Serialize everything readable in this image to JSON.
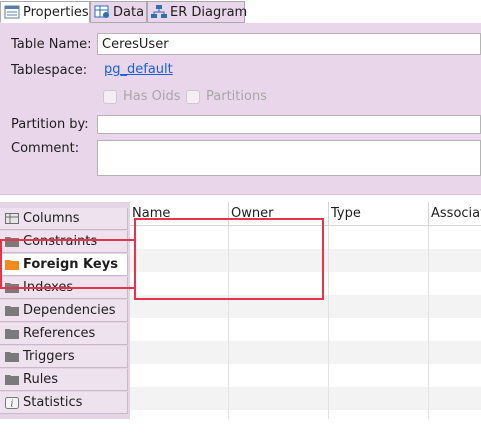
{
  "tabs": [
    {
      "label": "Properties",
      "icon": "properties-icon",
      "active": true
    },
    {
      "label": "Data",
      "icon": "data-icon",
      "active": false
    },
    {
      "label": "ER Diagram",
      "icon": "er-diagram-icon",
      "active": false
    }
  ],
  "form": {
    "table_name_label": "Table Name:",
    "table_name_value": "CeresUser",
    "tablespace_label": "Tablespace:",
    "tablespace_value": "pg_default",
    "has_oids_label": "Has Oids",
    "partitions_label": "Partitions",
    "partition_by_label": "Partition by:",
    "partition_by_value": "",
    "comment_label": "Comment:",
    "comment_value": ""
  },
  "sections": [
    {
      "label": "Columns",
      "icon": "columns-icon",
      "selected": false
    },
    {
      "label": "Constraints",
      "icon": "folder-icon",
      "selected": false
    },
    {
      "label": "Foreign Keys",
      "icon": "folder-orange-icon",
      "selected": true
    },
    {
      "label": "Indexes",
      "icon": "folder-icon",
      "selected": false
    },
    {
      "label": "Dependencies",
      "icon": "folder-icon",
      "selected": false
    },
    {
      "label": "References",
      "icon": "folder-icon",
      "selected": false
    },
    {
      "label": "Triggers",
      "icon": "folder-icon",
      "selected": false
    },
    {
      "label": "Rules",
      "icon": "folder-icon",
      "selected": false
    },
    {
      "label": "Statistics",
      "icon": "info-icon",
      "selected": false
    }
  ],
  "grid": {
    "columns": [
      "Name",
      "Owner",
      "Type",
      "Associat"
    ]
  },
  "colors": {
    "panel": "#e9d6ea",
    "link": "#1b5fd6",
    "annotation": "#e8334a",
    "folder": "#7a7a7a",
    "folder_active": "#f08a1c"
  }
}
